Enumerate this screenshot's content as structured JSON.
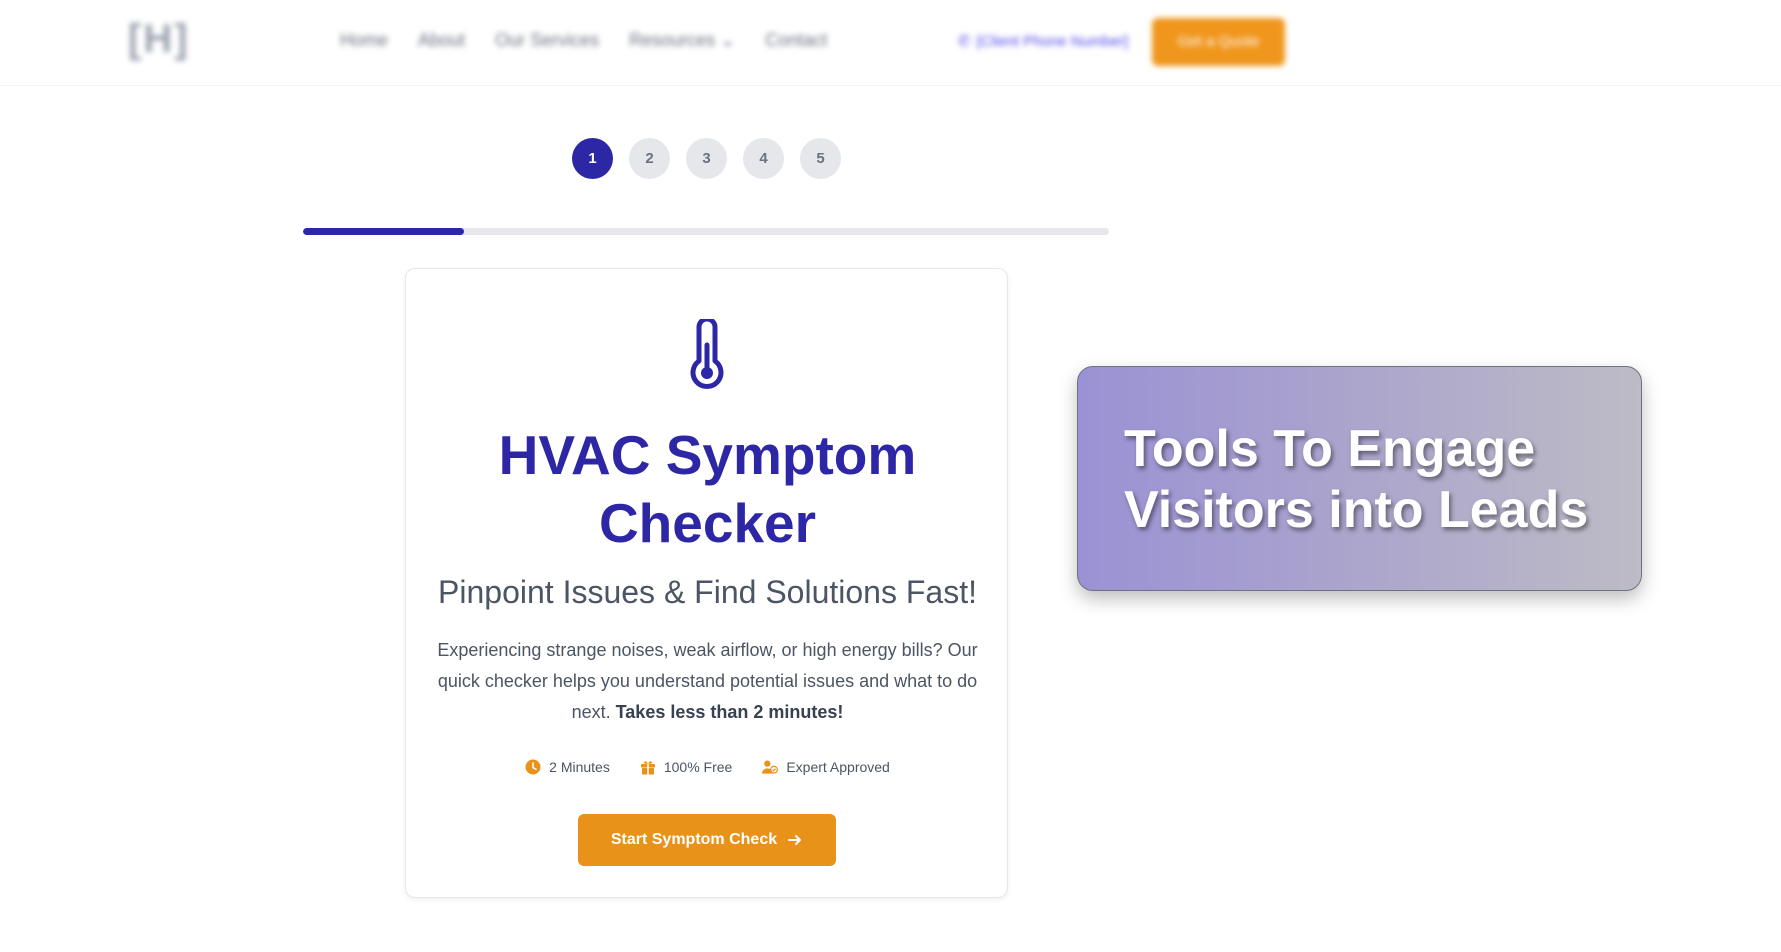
{
  "header": {
    "logo_text": "[H]",
    "nav": [
      {
        "label": "Home"
      },
      {
        "label": "About"
      },
      {
        "label": "Our Services"
      },
      {
        "label": "Resources"
      },
      {
        "label": "Contact"
      }
    ],
    "resources_caret": "⌄",
    "phone_label": "[Client Phone Number]",
    "quote_button": "Get a Quote"
  },
  "steps": [
    "1",
    "2",
    "3",
    "4",
    "5"
  ],
  "active_step": 1,
  "progress_fraction": 0.2,
  "colors": {
    "brand": "#2d27a5",
    "accent": "#e8921a",
    "muted": "#e5e7eb"
  },
  "card": {
    "icon": "thermometer-icon",
    "title": "HVAC Symptom Checker",
    "subtitle": "Pinpoint Issues & Find Solutions Fast!",
    "description": "Experiencing strange noises, weak airflow, or high energy bills? Our quick checker helps you understand potential issues and what to do next.",
    "description_emphasis": "Takes less than 2 minutes!",
    "features": [
      {
        "icon": "clock-icon",
        "label": "2 Minutes"
      },
      {
        "icon": "gift-icon",
        "label": "100% Free"
      },
      {
        "icon": "user-check-icon",
        "label": "Expert Approved"
      }
    ],
    "start_button": "Start Symptom Check",
    "start_button_icon": "arrow-right-icon"
  },
  "promo": {
    "text": "Tools To Engage Visitors into Leads"
  }
}
